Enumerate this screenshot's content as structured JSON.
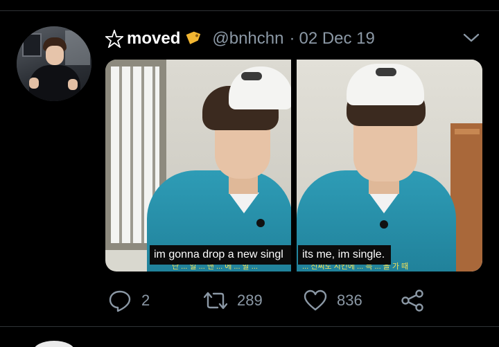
{
  "tweet": {
    "display_name": "moved",
    "handle": "@bnhchn",
    "separator": "·",
    "date": "02 Dec 19",
    "name_prefix_icon": "pentagram-icon",
    "name_suffix_icon": "tag-icon",
    "menu_icon": "chevron-down-icon"
  },
  "media": [
    {
      "subtitle": "im gonna drop a new singl",
      "korean_caption": "단 ... 일 ... 맨 ... 에 ... 발 ..."
    },
    {
      "subtitle": "its me, im single.",
      "korean_caption": "... 신씨도 시킨에 ... 득 ... 을 가 때"
    }
  ],
  "actions": {
    "reply_count": "2",
    "retweet_count": "289",
    "like_count": "836",
    "reply_icon": "reply-icon",
    "retweet_icon": "retweet-icon",
    "like_icon": "heart-icon",
    "share_icon": "share-icon"
  },
  "colors": {
    "background": "#000000",
    "primary_text": "#ffffff",
    "secondary_text": "#8b98a5",
    "divider": "#2f3336"
  }
}
